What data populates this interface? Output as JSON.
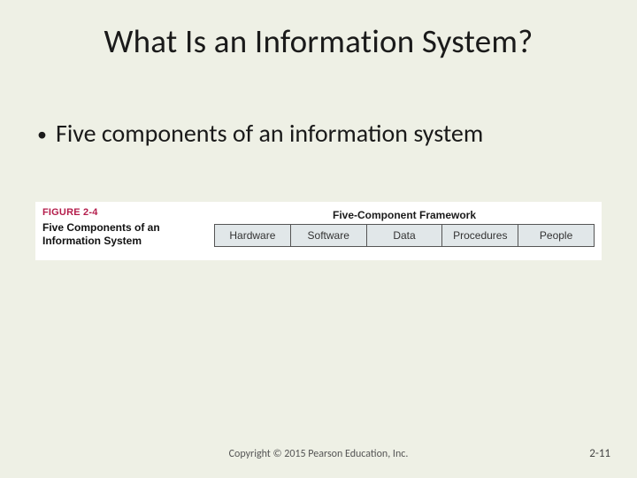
{
  "title": "What Is an Information System?",
  "bullet": {
    "marker": "•",
    "text": "Five components of an information system"
  },
  "figure": {
    "label": "FIGURE 2-4",
    "title": "Five Components of an Information System",
    "framework_label": "Five-Component Framework",
    "cells": {
      "c0": "Hardware",
      "c1": "Software",
      "c2": "Data",
      "c3": "Procedures",
      "c4": "People"
    }
  },
  "footer": {
    "copyright": "Copyright © 2015 Pearson Education, Inc.",
    "page": "2-11"
  }
}
